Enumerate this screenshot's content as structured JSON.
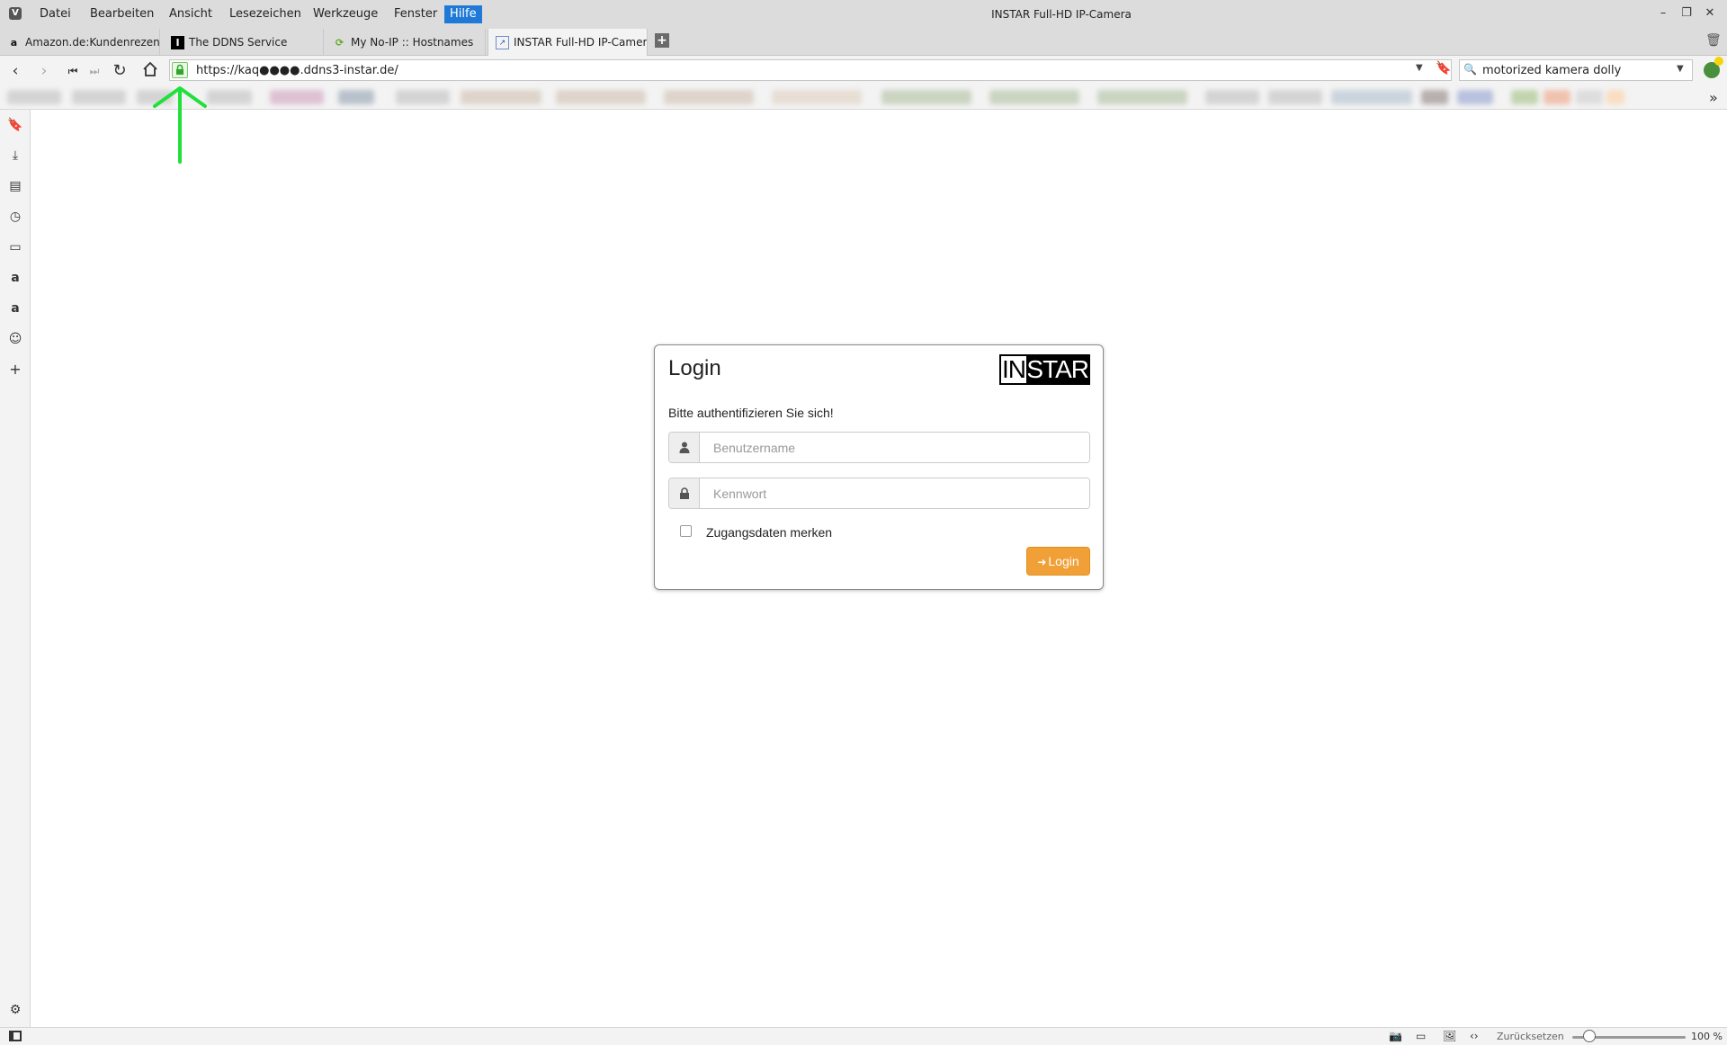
{
  "menu": {
    "items": [
      "Datei",
      "Bearbeiten",
      "Ansicht",
      "Lesezeichen",
      "Werkzeuge",
      "Fenster",
      "Hilfe"
    ],
    "active": "Hilfe"
  },
  "window": {
    "title": "INSTAR Full-HD IP-Camera"
  },
  "tabs": [
    {
      "label": "Amazon.de:Kundenrezens",
      "icon": "amazon-icon"
    },
    {
      "label": "The DDNS Service",
      "icon": "instar-icon"
    },
    {
      "label": "My No-IP :: Hostnames",
      "icon": "noip-icon"
    },
    {
      "label": "INSTAR Full-HD IP-Camera",
      "icon": "instar-camera-icon",
      "active": true
    }
  ],
  "address": {
    "url": "https://kaq●●●●.ddns3-instar.de/",
    "secure": true
  },
  "search": {
    "value": "motorized kamera dolly"
  },
  "login": {
    "title": "Login",
    "brand_left": "IN",
    "brand_right": "STAR",
    "instruction": "Bitte authentifizieren Sie sich!",
    "username_placeholder": "Benutzername",
    "password_placeholder": "Kennwort",
    "remember_label": "Zugangsdaten merken",
    "remember_checked": false,
    "button_label": "Login"
  },
  "status": {
    "zoom_reset": "Zurücksetzen",
    "zoom_level": "100 %",
    "zoom_fraction": 0.15
  },
  "colors": {
    "accent": "#1e7ad6",
    "login_button": "#f0a036",
    "lock": "#2fa52a",
    "annotation_arrow": "#22e03c"
  }
}
